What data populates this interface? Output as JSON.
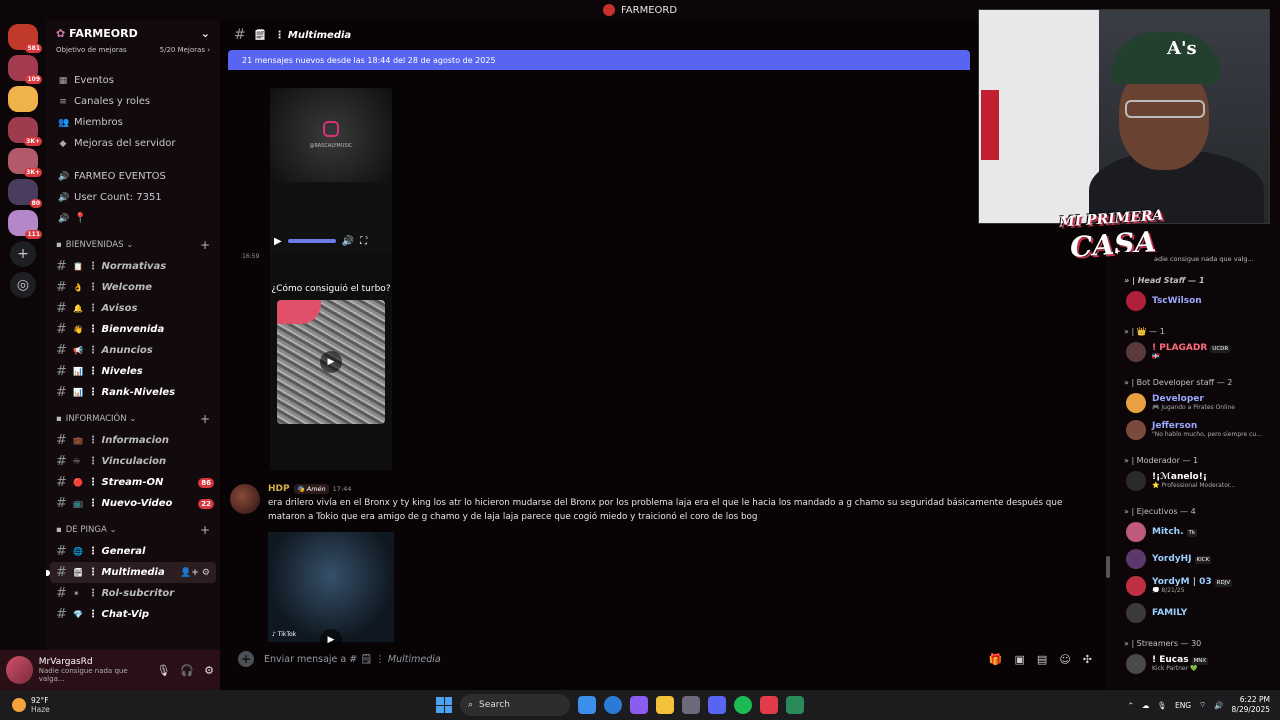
{
  "window": {
    "title": "FARMEORD"
  },
  "rail": {
    "servers": [
      {
        "color": "#c0392b",
        "badge": "581"
      },
      {
        "color": "#a33b4e",
        "badge": "109"
      },
      {
        "color": "#f0b24a",
        "badge": ""
      },
      {
        "color": "#9c3c4c",
        "badge": "3K+"
      },
      {
        "color": "#b25a6a",
        "badge": "3K+"
      },
      {
        "color": "#4a3c5c",
        "badge": "80"
      },
      {
        "color": "#b488c8",
        "badge": "111"
      }
    ],
    "add": "+",
    "discover": "◎"
  },
  "sidebar": {
    "server_name": "FARMEORD",
    "boost_goal": "Objetivo de mejoras",
    "boost_count": "5/20 Mejoras ›",
    "menu": [
      {
        "icon": "▦",
        "label": "Eventos"
      },
      {
        "icon": "≡",
        "label": "Canales y roles"
      },
      {
        "icon": "👥",
        "label": "Miembros"
      },
      {
        "icon": "◆",
        "label": "Mejoras del servidor"
      }
    ],
    "events_label": "FARMEO EVENTOS",
    "user_count": "User Count: 7351",
    "pin_label": "📍",
    "categories": [
      {
        "name": "BIENVENIDAS ⌄",
        "channels": [
          {
            "emoji": "📋",
            "name": "Normativas",
            "unread": false
          },
          {
            "emoji": "👌",
            "name": "Welcome",
            "unread": false
          },
          {
            "emoji": "🔔",
            "name": "Avisos",
            "unread": false
          },
          {
            "emoji": "👋",
            "name": "Bienvenida",
            "unread": true
          },
          {
            "emoji": "📢",
            "name": "Anuncios",
            "unread": false
          },
          {
            "emoji": "📊",
            "name": "Niveles",
            "unread": true
          },
          {
            "emoji": "📊",
            "name": "Rank-Niveles",
            "unread": true
          }
        ]
      },
      {
        "name": "INFORMACIÓN ⌄",
        "channels": [
          {
            "emoji": "💼",
            "name": "Informacion",
            "unread": false
          },
          {
            "emoji": "♾",
            "name": "Vinculacion",
            "unread": false
          },
          {
            "emoji": "🔴",
            "name": "Stream-ON",
            "unread": true,
            "count": "86"
          },
          {
            "emoji": "📺",
            "name": "Nuevo-Video",
            "unread": true,
            "count": "22"
          }
        ]
      },
      {
        "name": "DE PINGA ⌄",
        "channels": [
          {
            "emoji": "🌐",
            "name": "General",
            "unread": true
          },
          {
            "emoji": "🗒",
            "name": "Multimedia",
            "unread": true,
            "active": true
          },
          {
            "emoji": "✴",
            "name": "Rol-subcritor",
            "unread": false
          },
          {
            "emoji": "💎",
            "name": "Chat-Vip",
            "unread": true
          }
        ]
      }
    ]
  },
  "user_panel": {
    "name": "MrVargasRd",
    "status": "Nadie consigue nada que valga...",
    "mic": "🎙",
    "headphones": "🎧",
    "settings": "⚙"
  },
  "chat": {
    "channel_name": "Multimedia",
    "channel_emoji": "🗒",
    "new_messages_bar": "21 mensajes nuevos desde las 18:44 del 28 de agosto de 2025",
    "media1_handle": "@RASCALYMUSIC",
    "timestamp_small": "16:59",
    "media2_caption": "¿Cómo consiguió el turbo?",
    "message": {
      "author": "HDP",
      "role": "🎭 Amén",
      "time": "17:44",
      "text": "era drilero vivía en el Bronx y ty king los atr lo hicieron mudarse del Bronx por los problema laja era el que le hacia los mandado a g chamo su seguridad básicamente después que mataron a Tokio que era amigo de g chamo y de laja laja parece que cogió miedo y traicionó el coro de los bog"
    },
    "media3_tag": "♪ TikTok",
    "composer_placeholder": "Enviar mensaje a #",
    "composer_channel": "Multimedia"
  },
  "overlay": {
    "brand_top": "MI PRIMERA",
    "brand_bottom": "CASA",
    "cap_letters": "A's"
  },
  "members": {
    "top_status": "adie consigue nada que valg...",
    "groups": [
      {
        "title": "» | Head Staff — 1",
        "italic": true,
        "people": [
          {
            "name": "TscWilson",
            "color": "#9aa8ff",
            "av": "#b0203a",
            "tag": "",
            "sub": ""
          }
        ]
      },
      {
        "title": "» | 👑 — 1",
        "italic": false,
        "people": [
          {
            "name": "! PLAGADR",
            "color": "#ff6b7d",
            "av": "#5a3a3a",
            "tag": "UCDR",
            "sub": "🇩🇴"
          }
        ]
      },
      {
        "title": "» | Bot Developer staff — 2",
        "italic": false,
        "people": [
          {
            "name": "Developer",
            "color": "#9aa8ff",
            "av": "#e8a040",
            "tag": "",
            "sub": "🎮 Jugando a Pirates Online"
          },
          {
            "name": "Jefferson",
            "color": "#9aa8ff",
            "av": "#7a4a3a",
            "tag": "",
            "sub": "\"No hablo mucho, pero siempre cu..."
          }
        ]
      },
      {
        "title": "» | Moderador — 1",
        "italic": false,
        "people": [
          {
            "name": "!¡ℳanelo!¡",
            "color": "#ffffff",
            "av": "#2a2a2a",
            "tag": "",
            "sub": "⭐ Professional Moderator..."
          }
        ]
      },
      {
        "title": "» | Ejecutivos — 4",
        "italic": false,
        "people": [
          {
            "name": "Mitch.",
            "color": "#9ad0ff",
            "av": "#c05a7a",
            "tag": "Tk",
            "sub": ""
          },
          {
            "name": "YordyHJ",
            "color": "#9ad0ff",
            "av": "#5a3a6a",
            "tag": "KICK",
            "sub": ""
          },
          {
            "name": "YordyM | 03",
            "color": "#9ad0ff",
            "av": "#c03040",
            "tag": "RDJV",
            "sub": "💭 8/21/25"
          },
          {
            "name": "FAMILY",
            "color": "#9ad0ff",
            "av": "#3a3a3a",
            "tag": "",
            "sub": ""
          }
        ]
      },
      {
        "title": "» | Streamers — 30",
        "italic": false,
        "people": [
          {
            "name": "! Eucas",
            "color": "#ffffff",
            "av": "#4a4a4a",
            "tag": "MNX",
            "sub": "Kick Partner 💚"
          }
        ]
      }
    ]
  },
  "taskbar": {
    "temp": "92°F",
    "weather": "Haze",
    "search": "Search",
    "lang": "ENG",
    "time": "6:22 PM",
    "date": "8/29/2025",
    "apps": [
      "#3b8eea",
      "#2a7ad8",
      "#8a5cf0",
      "#f3c13a",
      "#6a6a7a",
      "#5865f2",
      "#1db954",
      "#e23b4a",
      "#2a8a5a"
    ]
  }
}
